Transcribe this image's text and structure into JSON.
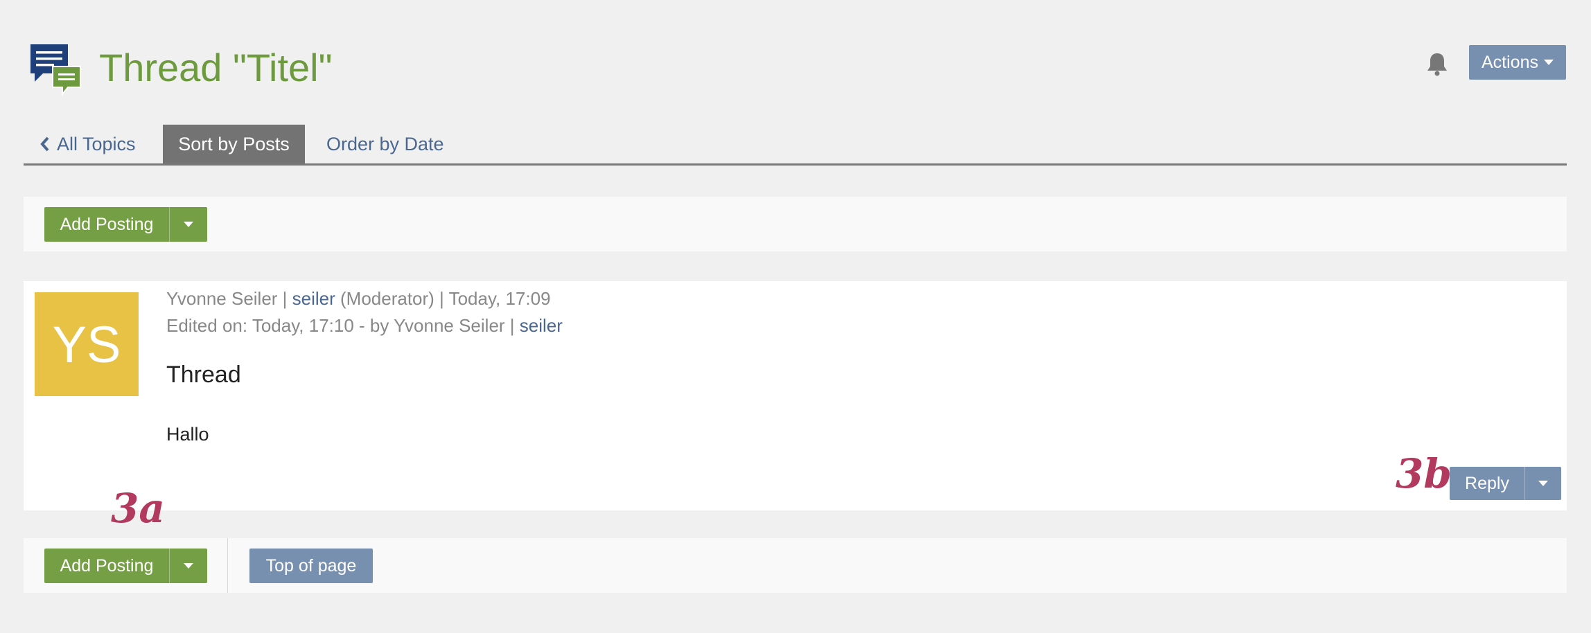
{
  "header": {
    "title": "Thread \"Titel\"",
    "actions_label": "Actions",
    "forum_icon": "forum-chat-icon",
    "bell_icon": "notification-bell-icon"
  },
  "tabs": {
    "back_label": "All Topics",
    "sort_label": "Sort by Posts",
    "order_label": "Order by Date"
  },
  "toolbar": {
    "add_posting_label": "Add Posting",
    "top_of_page_label": "Top of page"
  },
  "post": {
    "avatar_initials": "YS",
    "author_name": "Yvonne Seiler",
    "sep1": " | ",
    "author_login": "seiler",
    "author_role": " (Moderator) | Today, 17:09",
    "edited_text": "Edited on: Today, 17:10 - by Yvonne Seiler | ",
    "edited_login": "seiler",
    "title": "Thread",
    "body": "Hallo",
    "reply_label": "Reply"
  },
  "annotations": {
    "a": "3a",
    "b": "3b"
  },
  "colors": {
    "green": "#759f44",
    "title_green": "#6e9a3f",
    "blue_button": "#7890b0",
    "link": "#4a6790",
    "avatar": "#e8c245",
    "annotation": "#b13a5e"
  }
}
